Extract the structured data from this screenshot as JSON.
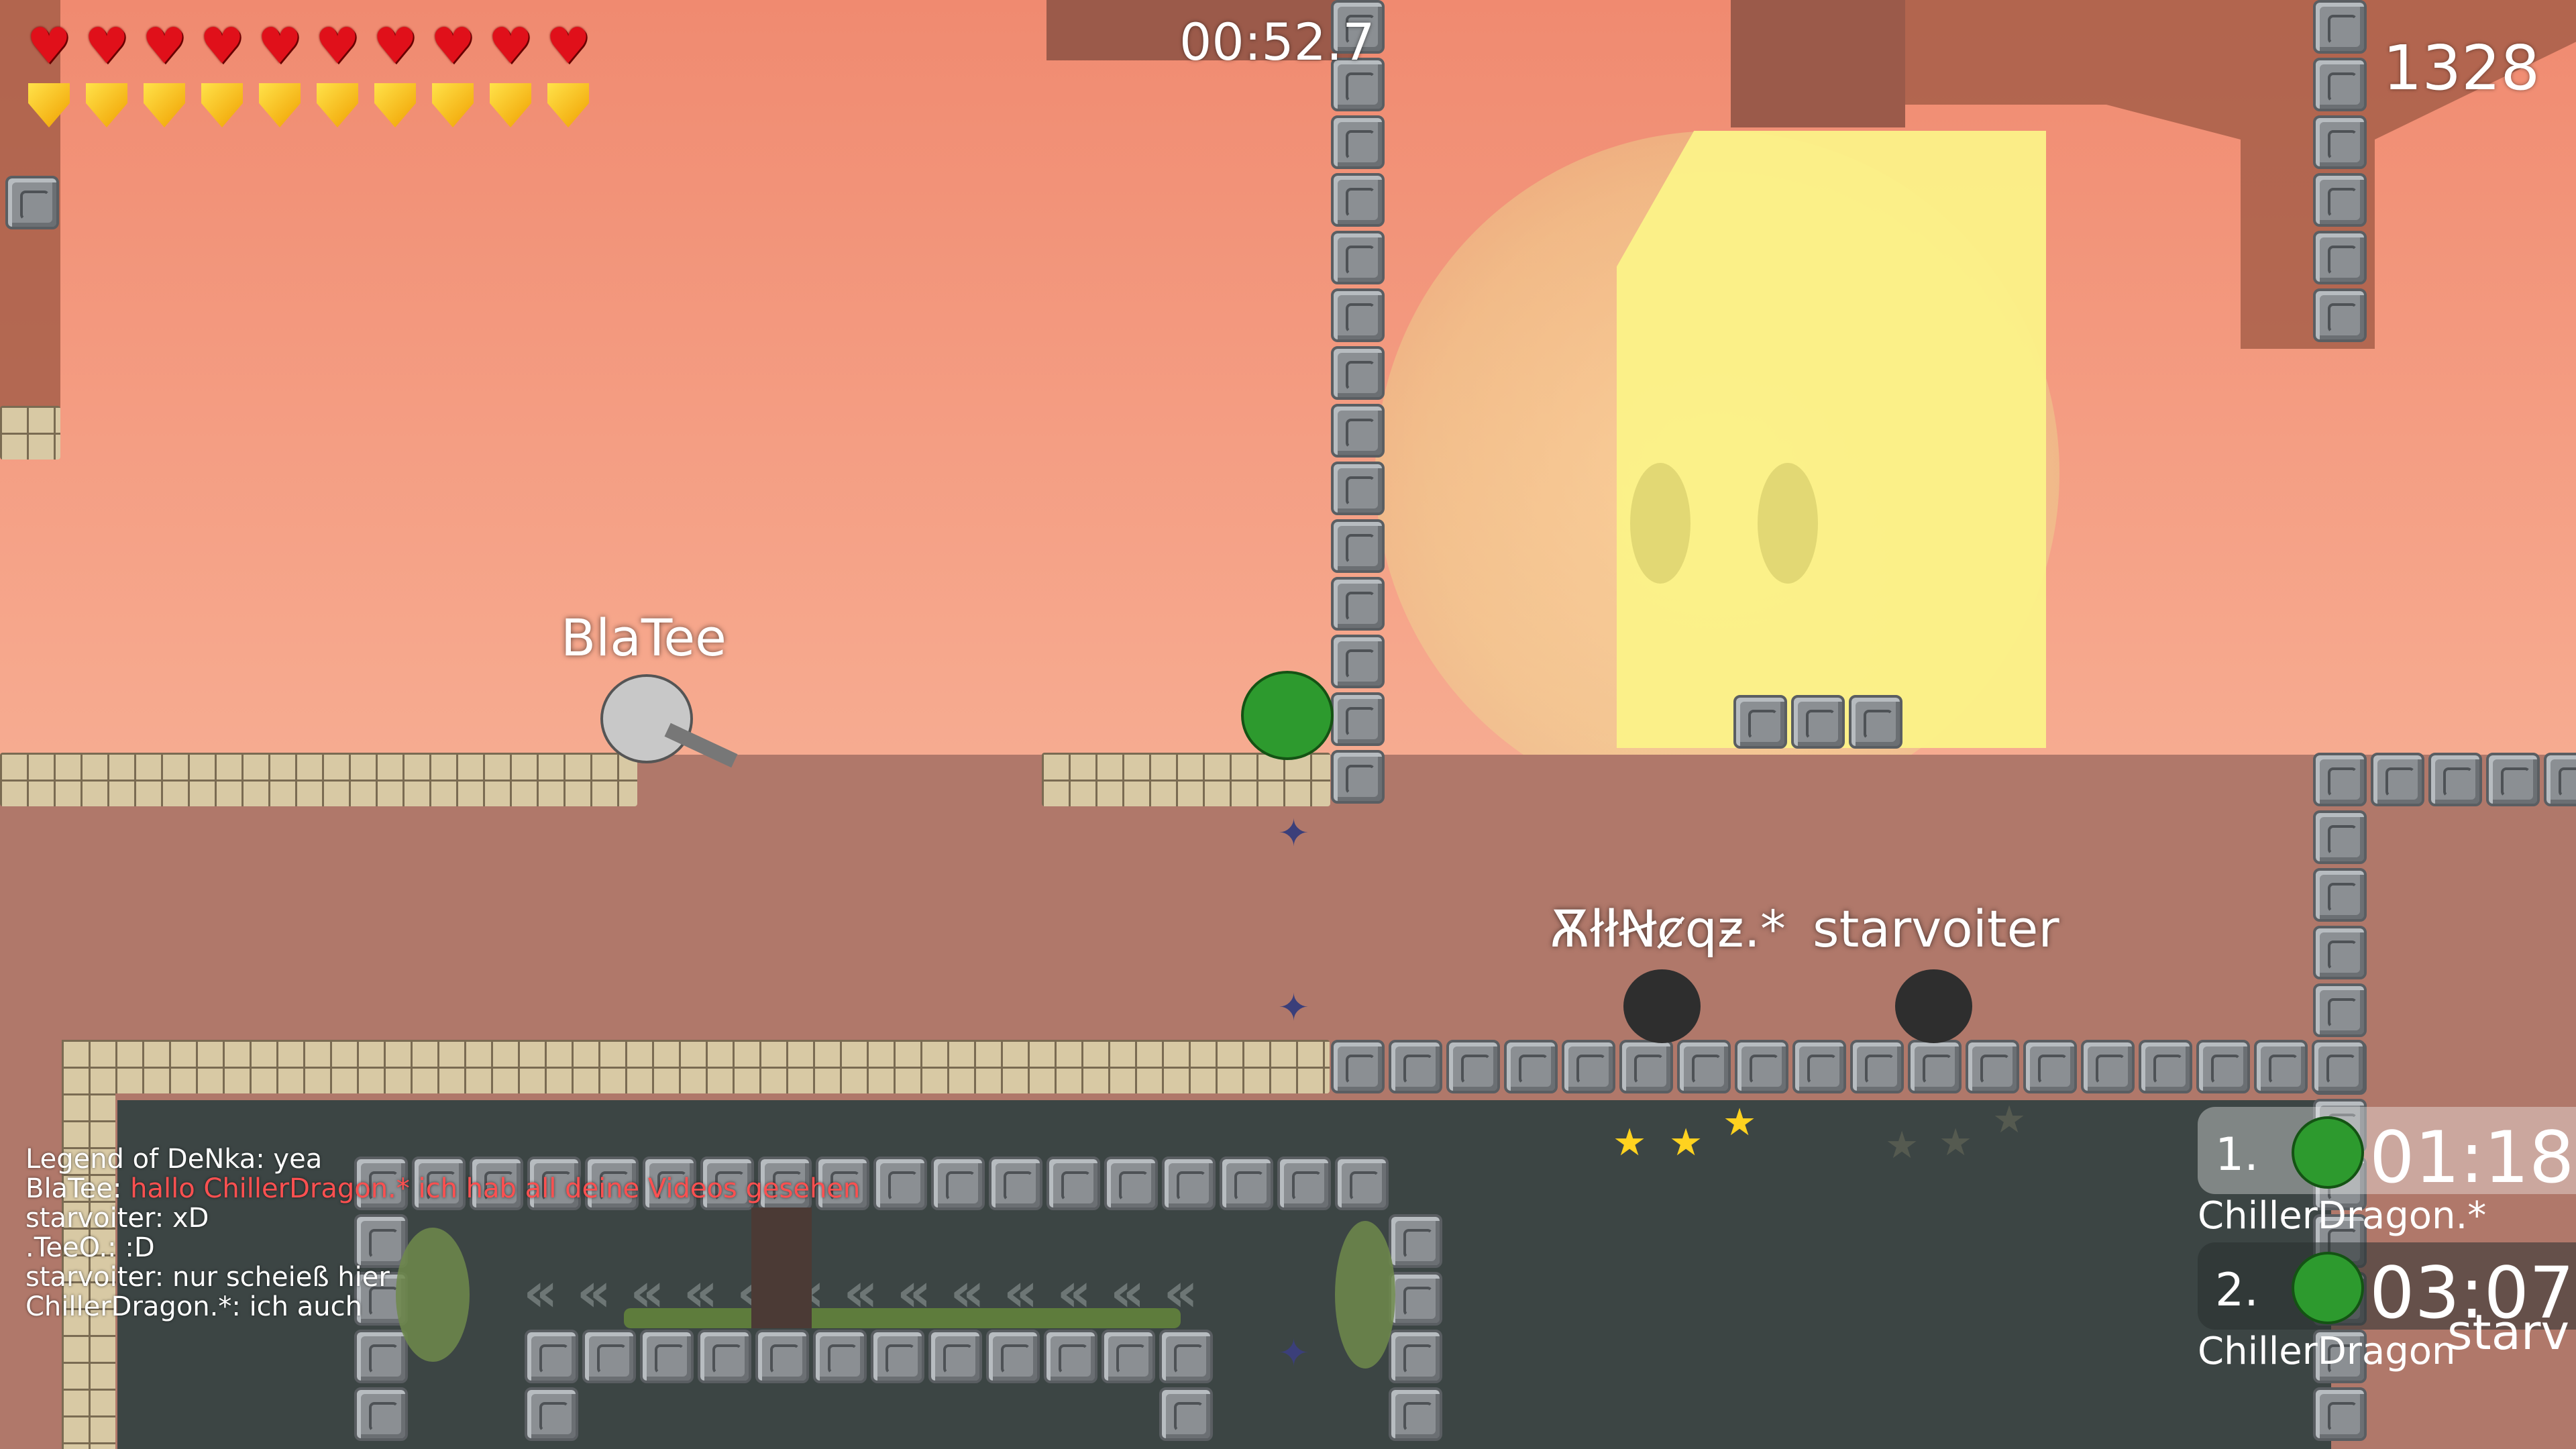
{
  "hud": {
    "timer": "00:52.7",
    "score": "1328",
    "health": 10,
    "armor": 10,
    "heart_icon": "heart-icon",
    "armor_icon": "shield-icon"
  },
  "players": {
    "bla_tee": "BlaTee",
    "player_2": "ѪłłꞤȼqƶ.*",
    "starvoiter": "starvoiter"
  },
  "chat": [
    {
      "author": "Legend of DeNka",
      "text": "yea",
      "highlight": false
    },
    {
      "author": "BlaTee",
      "text": "hallo ChillerDragon.* ich hab all deine Videos gesehen",
      "highlight": true
    },
    {
      "author": "starvoiter",
      "text": "xD",
      "highlight": false
    },
    {
      "author": ".TeeO.",
      "text": ":D",
      "highlight": false
    },
    {
      "author": "starvoiter",
      "text": "nur scheieß hier",
      "highlight": false
    },
    {
      "author": "ChillerDragon.*",
      "text": "ich auch",
      "highlight": false
    }
  ],
  "scoreboard": [
    {
      "rank": "1.",
      "time": "01:18",
      "name": "ChillerDragon.*"
    },
    {
      "rank": "2.",
      "time": "03:07",
      "name": "ChillerDragon",
      "overlap_name": "starv"
    }
  ],
  "colors": {
    "sky": "#f6a78c",
    "sun": "#fbf288",
    "heart": "#e0101a",
    "armor": "#ffd21f",
    "chat_highlight": "#ff5050"
  }
}
